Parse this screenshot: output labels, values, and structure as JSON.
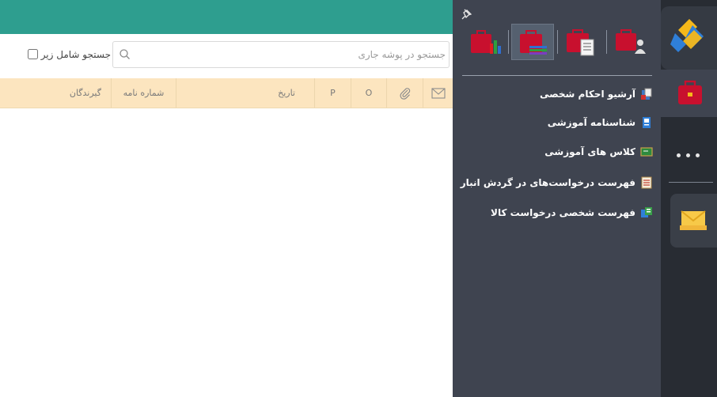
{
  "search": {
    "placeholder": "جستجو در پوشه جاری",
    "include_sub_label": "جستجو شامل زیر"
  },
  "table": {
    "columns": {
      "mail": "",
      "attachment": "",
      "o": "O",
      "p": "P",
      "date": "تاریخ",
      "letter_number": "شماره نامه",
      "recipients": "گیرندگان"
    }
  },
  "flyout": {
    "icons": [
      "briefcase-chart-icon",
      "briefcase-layers-icon",
      "briefcase-document-icon",
      "briefcase-user-icon"
    ],
    "menu_items": [
      {
        "label": "آرشیو احکام شخصی",
        "icon": "archive-icon"
      },
      {
        "label": "شناسنامه آموزشی",
        "icon": "id-card-icon"
      },
      {
        "label": "کلاس های آموزشی",
        "icon": "classroom-icon"
      },
      {
        "label": "فهرست درخواست‌های در گردش انبار",
        "icon": "list-document-icon"
      },
      {
        "label": "فهرست شخصی درخواست کالا",
        "icon": "goods-request-icon"
      }
    ]
  },
  "sidebar": {
    "items": [
      "app-logo-icon",
      "briefcase-icon",
      "more-icon",
      "mail-icon"
    ]
  },
  "colors": {
    "header": "#2e9e8f",
    "table_header": "#fce5bf",
    "flyout_bg": "#3f4450",
    "sidebar_bg": "#282c33"
  }
}
